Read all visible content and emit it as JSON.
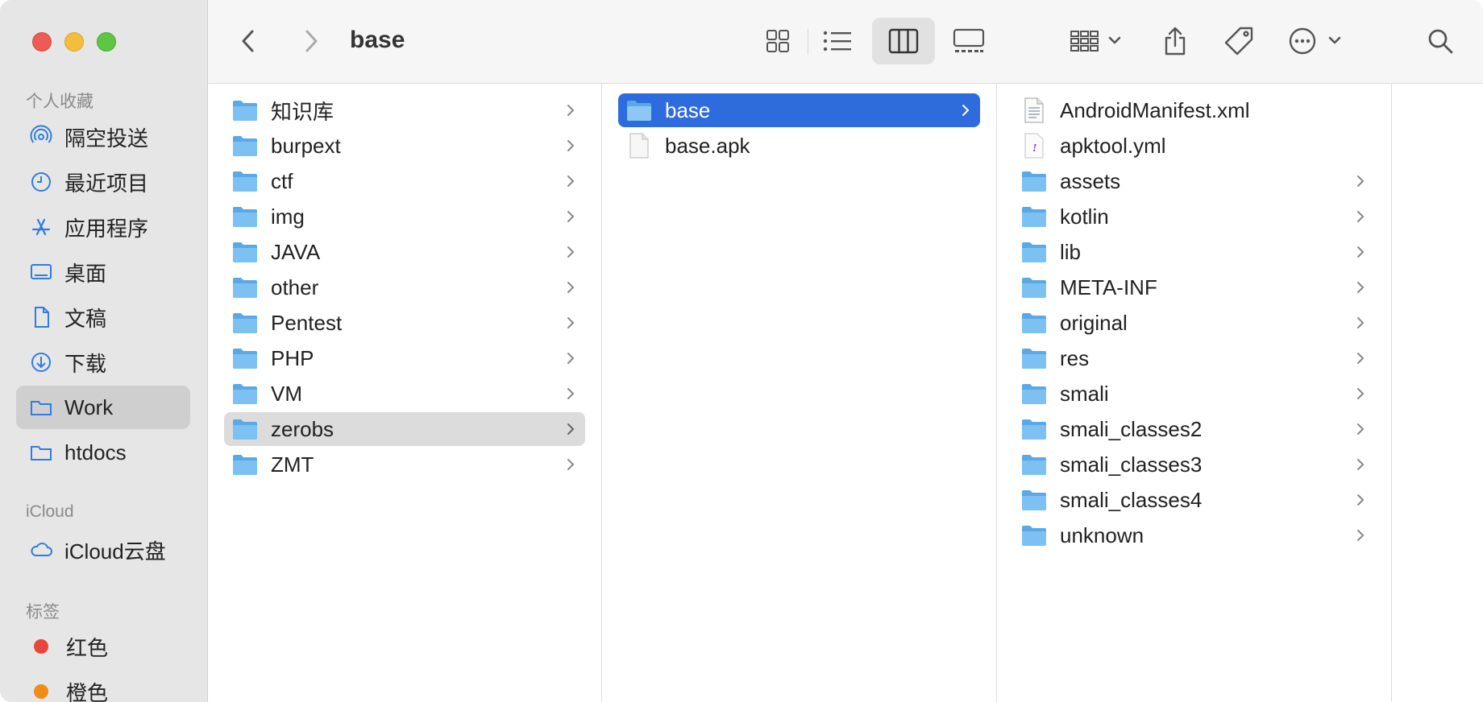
{
  "window": {
    "title": "base"
  },
  "colors": {
    "accent": "#2e6bdc",
    "folder": "#6cb6ec",
    "tag_red": "#e9453a",
    "tag_orange": "#f08c17"
  },
  "sidebar": {
    "favorites_header": "个人收藏",
    "favorites": [
      {
        "label": "隔空投送",
        "icon": "airdrop-icon"
      },
      {
        "label": "最近项目",
        "icon": "clock-icon"
      },
      {
        "label": "应用程序",
        "icon": "applications-icon"
      },
      {
        "label": "桌面",
        "icon": "desktop-icon"
      },
      {
        "label": "文稿",
        "icon": "document-icon"
      },
      {
        "label": "下载",
        "icon": "download-icon"
      },
      {
        "label": "Work",
        "icon": "folder-icon"
      },
      {
        "label": "htdocs",
        "icon": "folder-icon"
      }
    ],
    "icloud_header": "iCloud",
    "icloud": [
      {
        "label": "iCloud云盘",
        "icon": "cloud-icon"
      }
    ],
    "tags_header": "标签",
    "tags": [
      {
        "label": "红色",
        "color": "#e9453a"
      },
      {
        "label": "橙色",
        "color": "#f08c17"
      }
    ]
  },
  "columns": {
    "col1": [
      {
        "label": "知识库",
        "type": "folder"
      },
      {
        "label": "burpext",
        "type": "folder"
      },
      {
        "label": "ctf",
        "type": "folder"
      },
      {
        "label": "img",
        "type": "folder"
      },
      {
        "label": "JAVA",
        "type": "folder"
      },
      {
        "label": "other",
        "type": "folder"
      },
      {
        "label": "Pentest",
        "type": "folder"
      },
      {
        "label": "PHP",
        "type": "folder"
      },
      {
        "label": "VM",
        "type": "folder"
      },
      {
        "label": "zerobs",
        "type": "folder"
      },
      {
        "label": "ZMT",
        "type": "folder"
      }
    ],
    "col2": [
      {
        "label": "base",
        "type": "folder"
      },
      {
        "label": "base.apk",
        "type": "file"
      }
    ],
    "col3": [
      {
        "label": "AndroidManifest.xml",
        "type": "xml"
      },
      {
        "label": "apktool.yml",
        "type": "yml"
      },
      {
        "label": "assets",
        "type": "folder"
      },
      {
        "label": "kotlin",
        "type": "folder"
      },
      {
        "label": "lib",
        "type": "folder"
      },
      {
        "label": "META-INF",
        "type": "folder"
      },
      {
        "label": "original",
        "type": "folder"
      },
      {
        "label": "res",
        "type": "folder"
      },
      {
        "label": "smali",
        "type": "folder"
      },
      {
        "label": "smali_classes2",
        "type": "folder"
      },
      {
        "label": "smali_classes3",
        "type": "folder"
      },
      {
        "label": "smali_classes4",
        "type": "folder"
      },
      {
        "label": "unknown",
        "type": "folder"
      }
    ]
  }
}
